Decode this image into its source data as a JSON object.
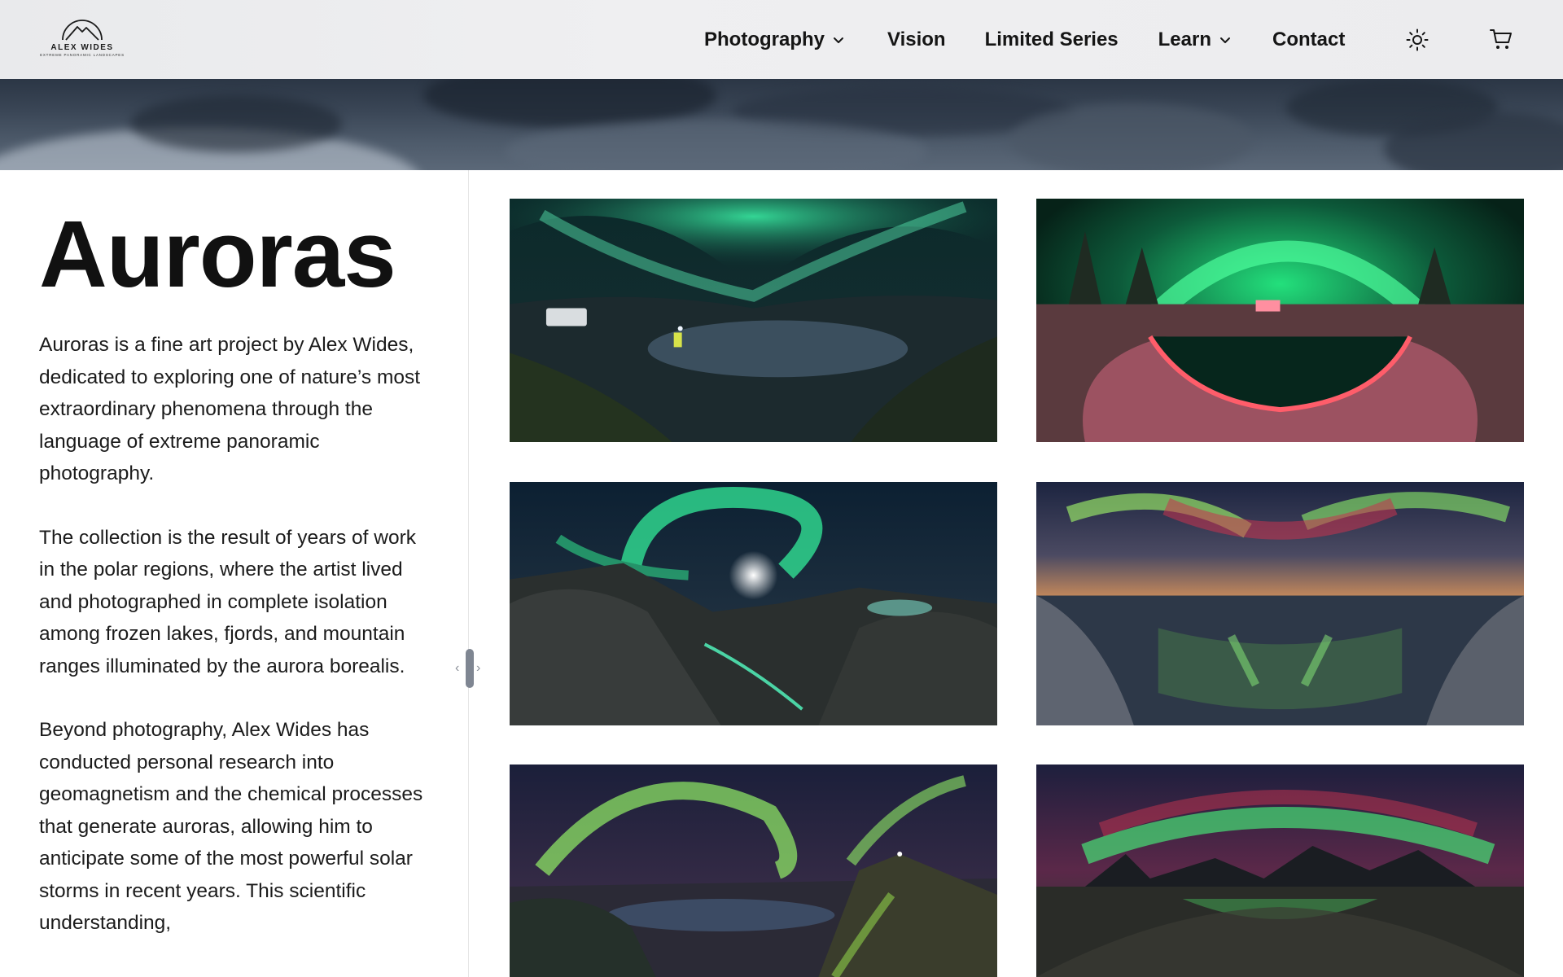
{
  "brand": {
    "name": "ALEX WIDES",
    "tagline": "EXTREME PANORAMIC LANDSCAPES"
  },
  "nav": {
    "items": [
      {
        "label": "Photography",
        "has_dropdown": true
      },
      {
        "label": "Vision",
        "has_dropdown": false
      },
      {
        "label": "Limited Series",
        "has_dropdown": false
      },
      {
        "label": "Learn",
        "has_dropdown": true
      },
      {
        "label": "Contact",
        "has_dropdown": false
      }
    ],
    "theme_icon": "sun-icon",
    "cart_icon": "cart-icon"
  },
  "page": {
    "title": "Auroras",
    "paragraphs": [
      "Auroras is a fine art project by Alex Wides, dedicated to exploring one of nature’s most extraordinary phenomena through the language of extreme panoramic photography.",
      "The collection is the result of years of work in the polar regions, where the artist lived and photographed in complete isolation among frozen lakes, fjords, and mountain ranges illuminated by the aurora borealis.",
      "Beyond photography, Alex Wides has conducted personal research into geomagnetism and the chemical processes that generate auroras, allowing him to anticipate some of the most powerful solar storms in recent years. This scientific understanding,"
    ]
  },
  "gallery": {
    "photos": [
      {
        "subject": "aurora over lake with camper van and hiker"
      },
      {
        "subject": "green aurora arc over frozen lake with red-lit shore"
      },
      {
        "subject": "aurora spiral over mountain valley with moon"
      },
      {
        "subject": "red and green aurora over rocky coastal reflection"
      },
      {
        "subject": "green aurora arc over fjord with figure on summit"
      },
      {
        "subject": "red and green aurora over mountain range and beach"
      }
    ]
  },
  "colors": {
    "header_bg": "#eeeef0",
    "text": "#111111",
    "aurora_green": "#2fe08a",
    "aurora_red": "#c8334f"
  }
}
